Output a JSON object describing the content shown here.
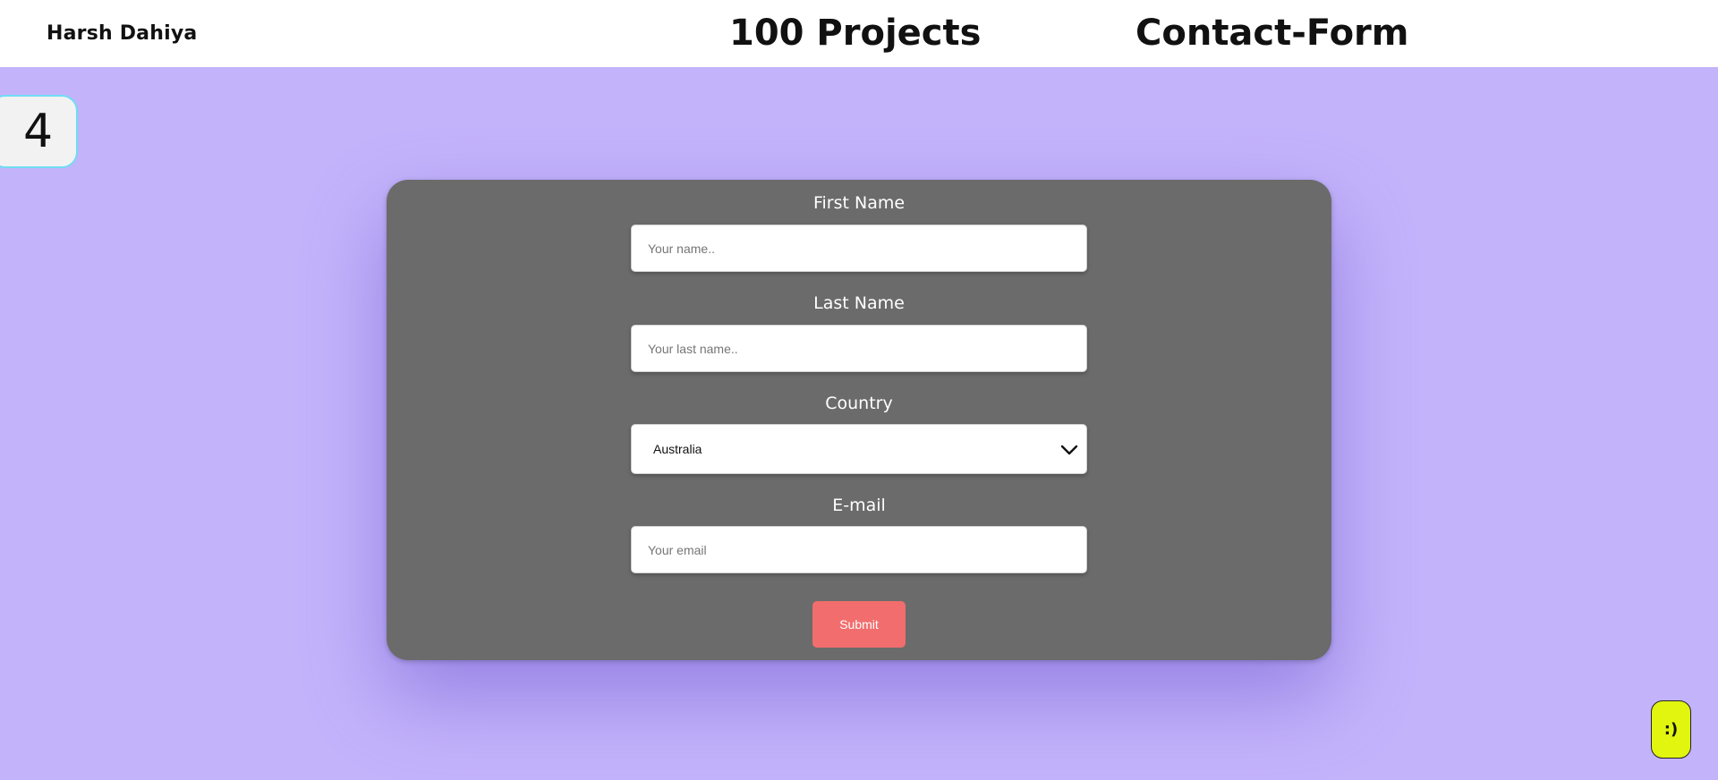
{
  "header": {
    "brand": "Harsh Dahiya",
    "title_left": "100 Projects",
    "title_right": "Contact-Form"
  },
  "project_number": "4",
  "form": {
    "first_name": {
      "label": "First Name",
      "placeholder": "Your name.."
    },
    "last_name": {
      "label": "Last Name",
      "placeholder": "Your last name.."
    },
    "country": {
      "label": "Country",
      "selected": "Australia"
    },
    "email": {
      "label": "E-mail",
      "placeholder": "Your email"
    },
    "submit_label": "Submit"
  },
  "smiley": ":)",
  "colors": {
    "background": "#c3b3fb",
    "card": "#6b6b6b",
    "submit": "#f26d6d",
    "smiley_badge": "#e2f50f",
    "number_badge_border": "#6fdcf2"
  }
}
